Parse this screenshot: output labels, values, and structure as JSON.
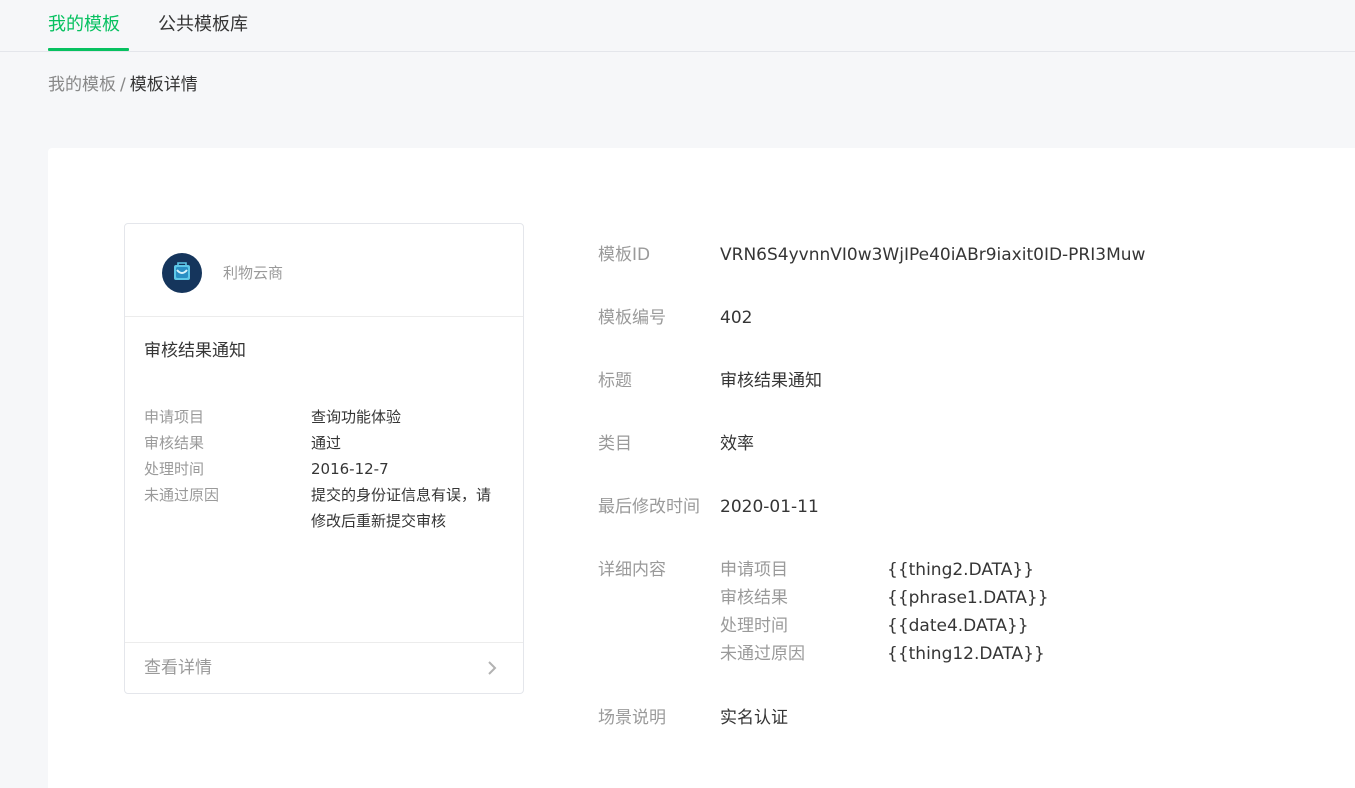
{
  "tabs": [
    {
      "label": "我的模板",
      "active": true
    },
    {
      "label": "公共模板库",
      "active": false
    }
  ],
  "breadcrumb": {
    "parent": "我的模板",
    "separator": "/",
    "current": "模板详情"
  },
  "preview_card": {
    "account_name": "利物云商",
    "title": "审核结果通知",
    "fields": [
      {
        "key": "申请项目",
        "value": "查询功能体验"
      },
      {
        "key": "审核结果",
        "value": "通过"
      },
      {
        "key": "处理时间",
        "value": "2016-12-7"
      },
      {
        "key": "未通过原因",
        "value": "提交的身份证信息有误，请修改后重新提交审核"
      }
    ],
    "footer_label": "查看详情",
    "avatar_icon": "bag-logo-icon",
    "footer_icon": "chevron-right-icon"
  },
  "info": {
    "template_id_label": "模板ID",
    "template_id": "VRN6S4yvnnVI0w3WjIPe40iABr9iaxit0ID-PRI3Muw",
    "number_label": "模板编号",
    "number": "402",
    "title_label": "标题",
    "title": "审核结果通知",
    "category_label": "类目",
    "category": "效率",
    "modified_label": "最后修改时间",
    "modified": "2020-01-11",
    "detail_label": "详细内容",
    "details": [
      {
        "key": "申请项目",
        "value": "{{thing2.DATA}}"
      },
      {
        "key": "审核结果",
        "value": "{{phrase1.DATA}}"
      },
      {
        "key": "处理时间",
        "value": "{{date4.DATA}}"
      },
      {
        "key": "未通过原因",
        "value": "{{thing12.DATA}}"
      }
    ],
    "scene_label": "场景说明",
    "scene": "实名认证"
  },
  "colors": {
    "accent": "#07c160",
    "text": "#353535",
    "muted": "#9a9a9a"
  }
}
